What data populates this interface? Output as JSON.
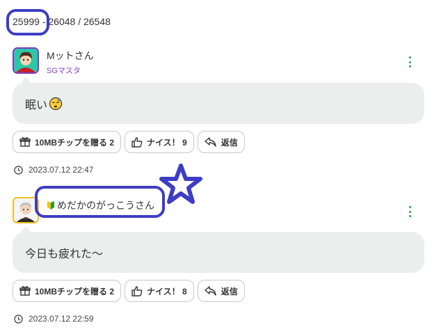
{
  "pagination": {
    "text": "25999 - 26048 / 26548"
  },
  "posts": [
    {
      "user": {
        "name": "Mットさん",
        "rank": "SGマスタ"
      },
      "body": "眠い",
      "emoji_icon": "sleepy-face-icon",
      "actions": {
        "chip_label": "10MBチップを贈る 2",
        "nice_label": "ナイス！ 9",
        "reply_label": "返信"
      },
      "timestamp": "2023.07.12 22:47"
    },
    {
      "user": {
        "name": "めだかのがっこうさん",
        "rank": ""
      },
      "badge_icon": "beginner-mark-icon",
      "body": "今日も疲れた〜",
      "actions": {
        "chip_label": "10MBチップを贈る 2",
        "nice_label": "ナイス！ 8",
        "reply_label": "返信"
      },
      "timestamp": "2023.07.12 22:59"
    }
  ],
  "annotation": {
    "color": "#3d3dc4",
    "star_icon": "star-outline-icon"
  },
  "colors": {
    "bubble": "#ebeeec",
    "rank": "#8a3cc8",
    "menu_dots": "#22a04a",
    "avatar_border_1": "#7a3cc4",
    "avatar_border_2": "#f0c020"
  }
}
